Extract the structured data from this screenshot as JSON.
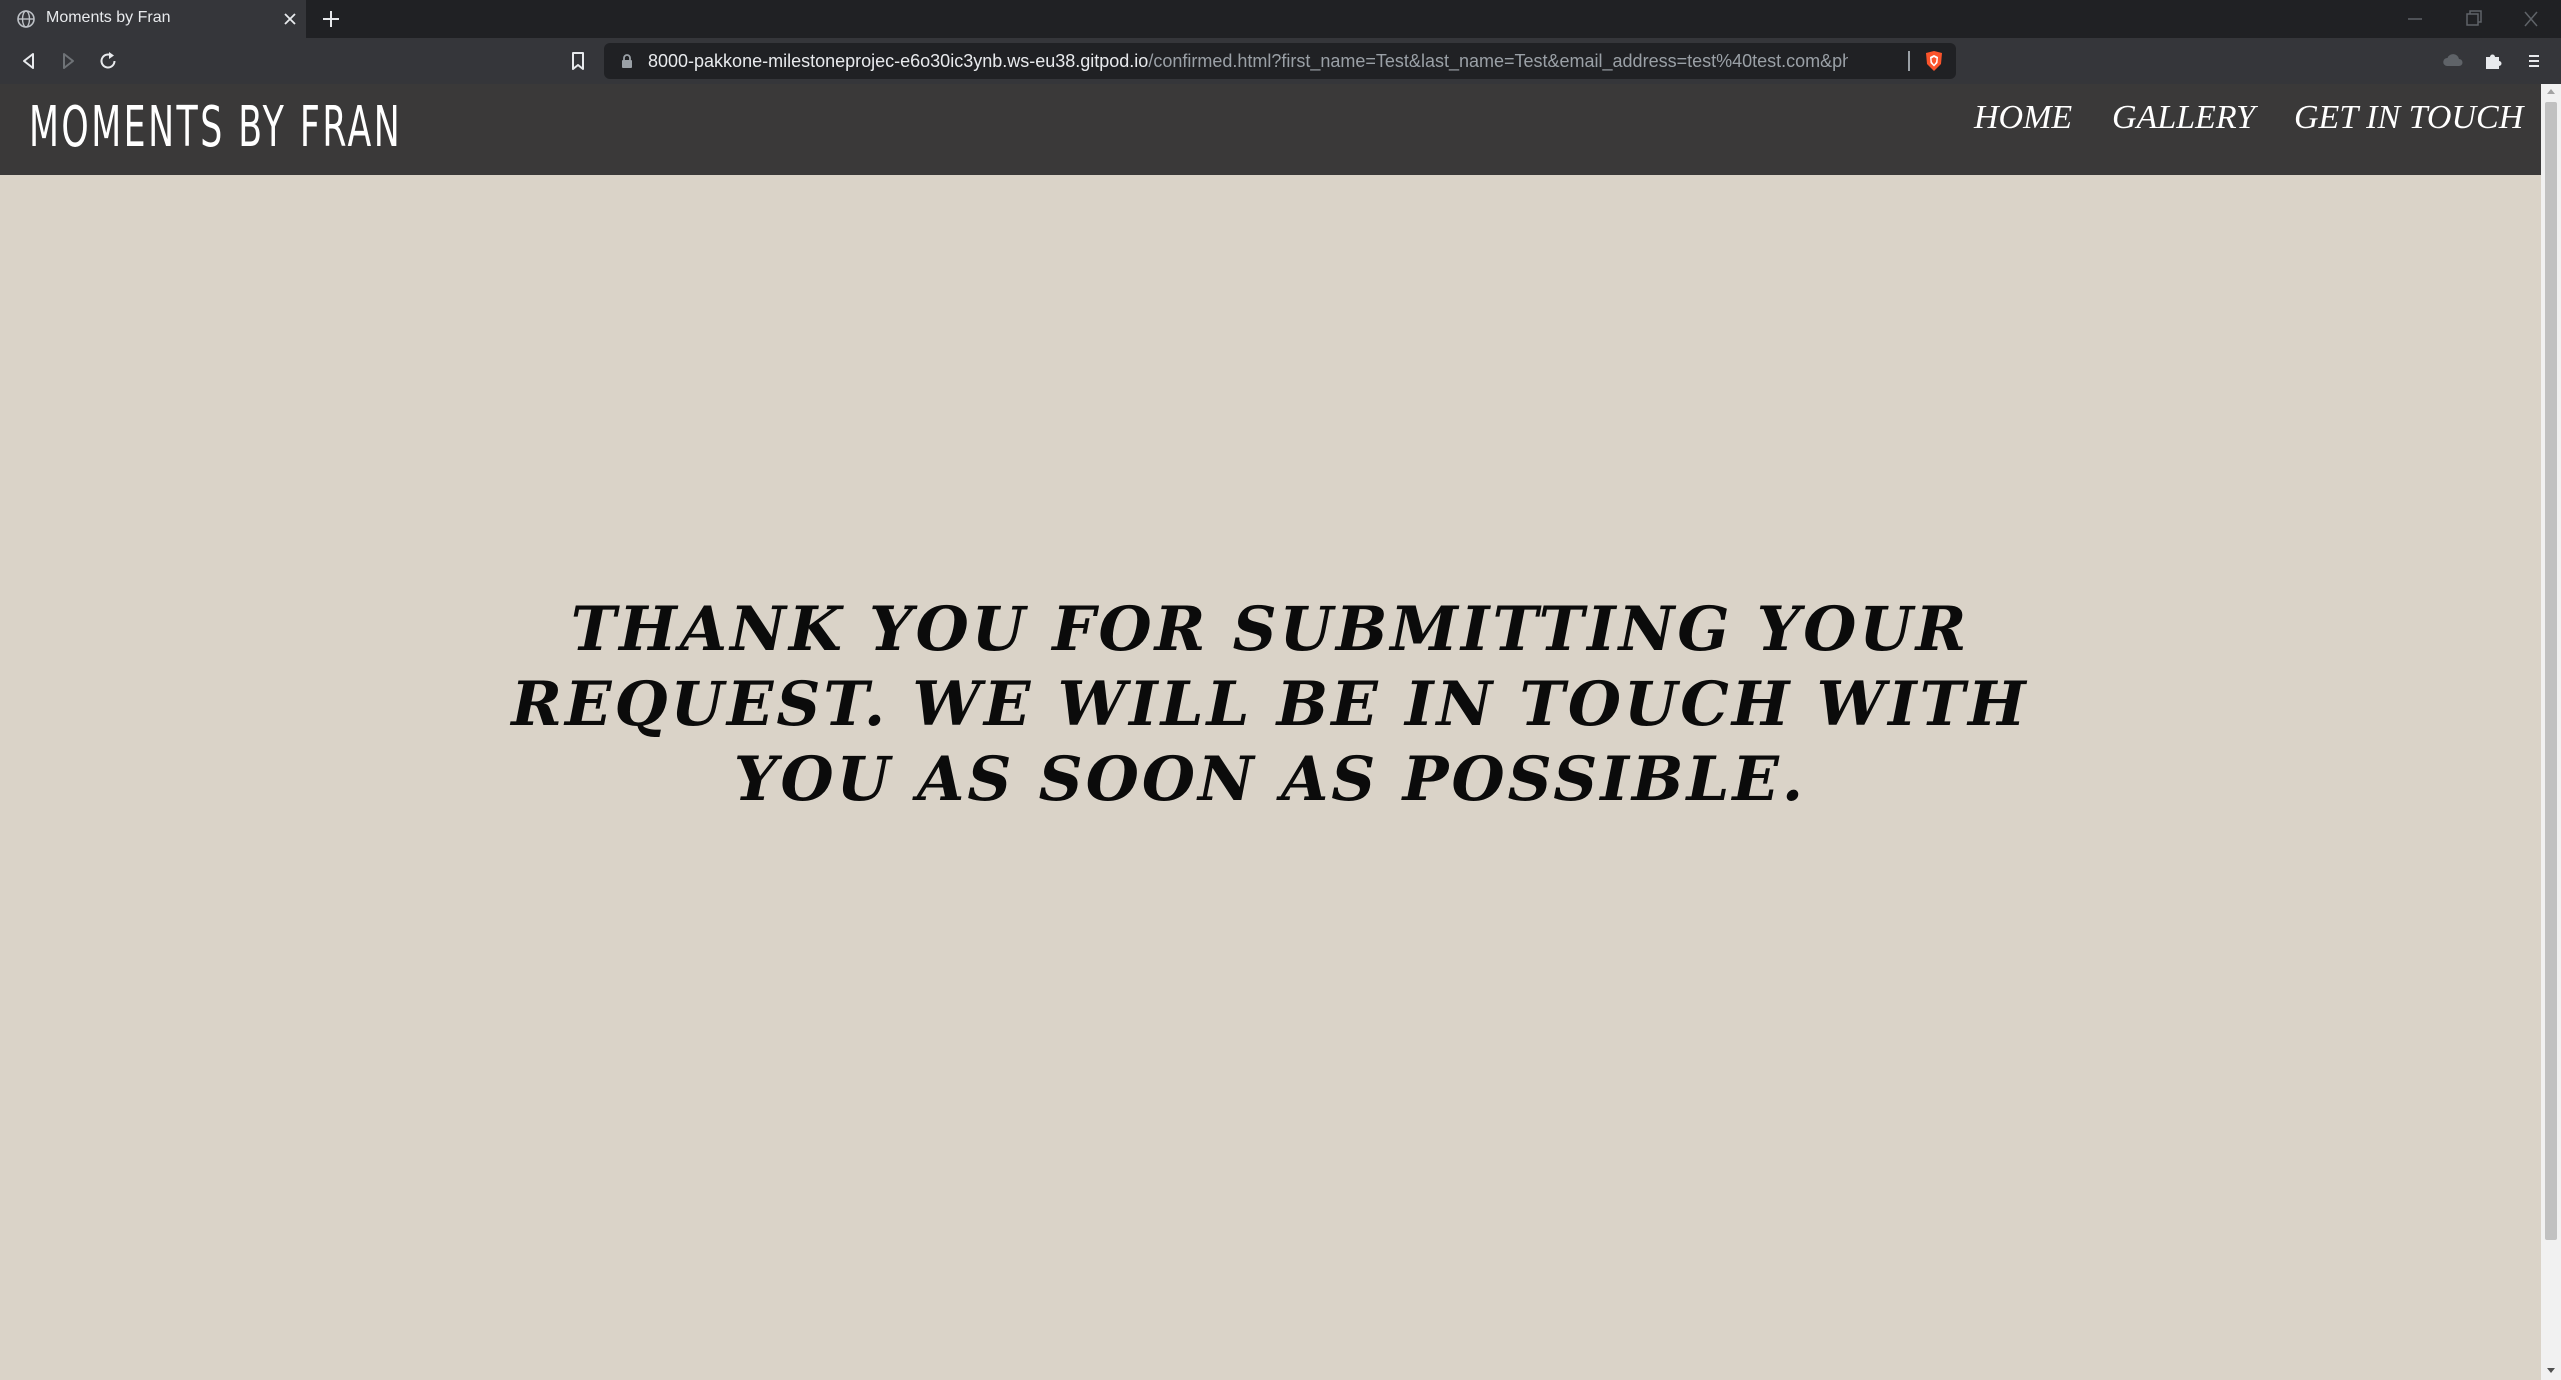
{
  "browser": {
    "tab": {
      "title": "Moments by Fran",
      "favicon": "globe-icon",
      "close_icon": "close-icon"
    },
    "new_tab_icon": "plus-icon",
    "window_controls": [
      "minimize-icon",
      "restore-icon",
      "close-icon"
    ],
    "toolbar": {
      "back_icon": "back-icon",
      "forward_icon": "forward-icon",
      "reload_icon": "reload-icon",
      "bookmark_icon": "bookmark-icon",
      "lock_icon": "lock-icon",
      "url_host": "8000-pakkone-milestoneprojec-e6o30ic3ynb.ws-eu38.gitpod.io",
      "url_path": "/confirmed.html?first_name=Test&last_name=Test&email_address=test%40test.com&phone_nu...",
      "brave_shield_icon": "brave-shield-icon",
      "cloud_icon": "cloud-icon",
      "extensions_icon": "puzzle-icon",
      "menu_icon": "hamburger-menu-icon"
    }
  },
  "site": {
    "brand": "MOMENTS BY FRAN",
    "nav": [
      "HOME",
      "GALLERY",
      "GET IN TOUCH"
    ],
    "message": "THANK YOU FOR SUBMITTING YOUR REQUEST. WE WILL BE IN TOUCH WITH YOU AS SOON AS POSSIBLE."
  },
  "colors": {
    "page_background": "#dad3c8",
    "header_background": "#3a3939",
    "browser_frame": "#202124",
    "browser_toolbar": "#35363a",
    "text_dark": "#0b0b0b",
    "text_light": "#ffffff"
  }
}
